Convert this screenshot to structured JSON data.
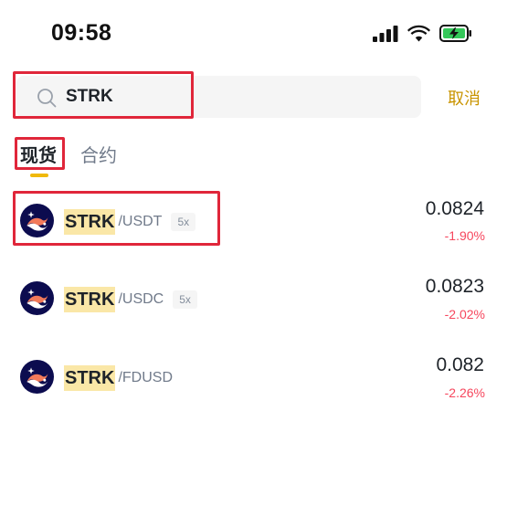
{
  "status_bar": {
    "time": "09:58",
    "icons": [
      "signal-icon",
      "wifi-icon",
      "battery-charging-icon"
    ],
    "battery_color": "#34c759"
  },
  "search": {
    "value": "STRK",
    "placeholder": "",
    "cancel_label": "取消",
    "accent_color": "#c99400"
  },
  "tabs": [
    {
      "label": "现货",
      "active": true
    },
    {
      "label": "合约",
      "active": false
    }
  ],
  "results": [
    {
      "base": "STRK",
      "quote": "/USDT",
      "leverage": "5x",
      "price": "0.0824",
      "change": "-1.90%"
    },
    {
      "base": "STRK",
      "quote": "/USDC",
      "leverage": "5x",
      "price": "0.0823",
      "change": "-2.02%"
    },
    {
      "base": "STRK",
      "quote": "/FDUSD",
      "leverage": "",
      "price": "0.082",
      "change": "-2.26%"
    }
  ],
  "colors": {
    "highlight_box": "#e0263a",
    "down": "#f6465d",
    "tab_indicator": "#f0b90b",
    "match_highlight": "#fae7a7"
  }
}
